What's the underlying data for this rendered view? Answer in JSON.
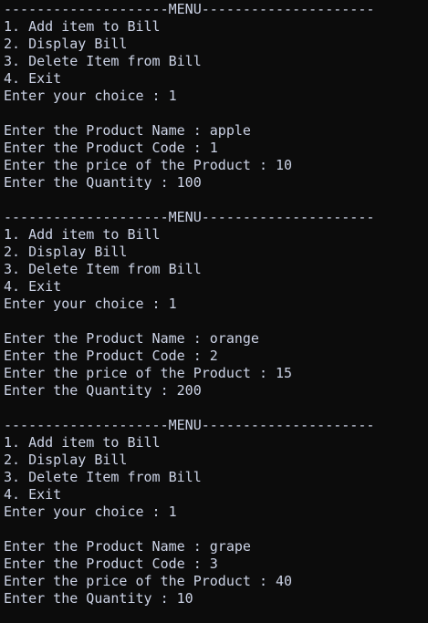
{
  "terminal": {
    "lines": [
      "--------------------MENU---------------------",
      "1. Add item to Bill",
      "2. Display Bill",
      "3. Delete Item from Bill",
      "4. Exit",
      "Enter your choice : 1",
      "",
      "Enter the Product Name : apple",
      "Enter the Product Code : 1",
      "Enter the price of the Product : 10",
      "Enter the Quantity : 100",
      "",
      "--------------------MENU---------------------",
      "1. Add item to Bill",
      "2. Display Bill",
      "3. Delete Item from Bill",
      "4. Exit",
      "Enter your choice : 1",
      "",
      "Enter the Product Name : orange",
      "Enter the Product Code : 2",
      "Enter the price of the Product : 15",
      "Enter the Quantity : 200",
      "",
      "--------------------MENU---------------------",
      "1. Add item to Bill",
      "2. Display Bill",
      "3. Delete Item from Bill",
      "4. Exit",
      "Enter your choice : 1",
      "",
      "Enter the Product Name : grape",
      "Enter the Product Code : 3",
      "Enter the price of the Product : 40",
      "Enter the Quantity : 10"
    ]
  },
  "colors": {
    "background": "#0c0c0c",
    "text": "#ccd3e6"
  }
}
